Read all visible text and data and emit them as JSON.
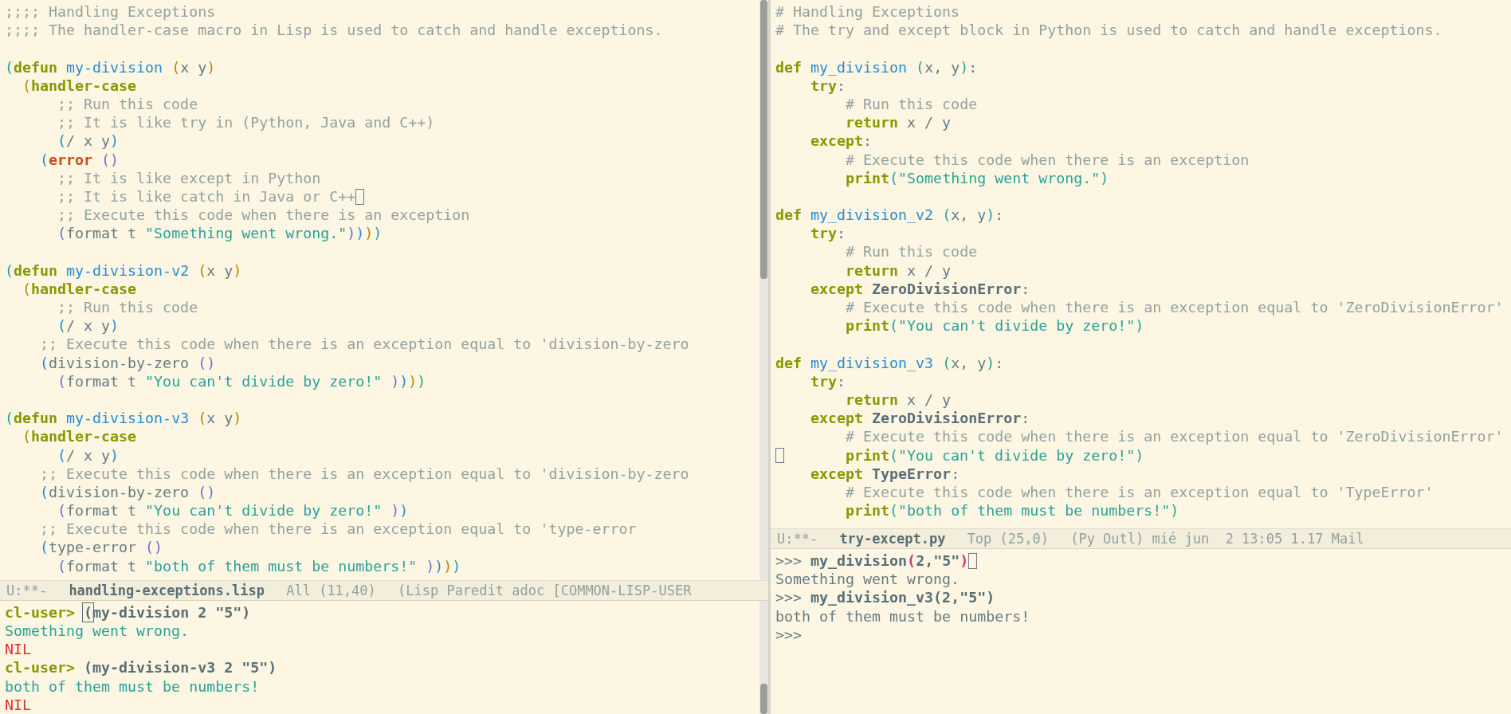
{
  "left_editor": {
    "lines": [
      {
        "tokens": [
          {
            "kind": "c",
            "text": ";;;; Handling Exceptions"
          }
        ]
      },
      {
        "tokens": [
          {
            "kind": "c",
            "text": ";;;; The handler-case macro in Lisp is used to catch and handle exceptions."
          }
        ]
      },
      {
        "space_before": true,
        "tokens": [
          {
            "kind": "p1",
            "text": "("
          },
          {
            "kind": "k",
            "text": "defun"
          },
          {
            "kind": "f",
            "text": " my-division"
          },
          {
            "kind": "p2",
            "text": " ("
          },
          {
            "kind": "t",
            "text": "x y"
          },
          {
            "kind": "p2",
            "text": ")"
          }
        ]
      },
      {
        "tokens": [
          {
            "kind": "p2",
            "text": "  ("
          },
          {
            "kind": "k",
            "text": "handler-case"
          }
        ]
      },
      {
        "tokens": [
          {
            "kind": "c",
            "text": "      ;; Run this code"
          }
        ]
      },
      {
        "tokens": [
          {
            "kind": "c",
            "text": "      ;; It is like try in (Python, Java and C++)"
          }
        ]
      },
      {
        "tokens": [
          {
            "kind": "p3",
            "text": "      ("
          },
          {
            "kind": "t",
            "text": "/ x y"
          },
          {
            "kind": "p3",
            "text": ")"
          }
        ]
      },
      {
        "tokens": [
          {
            "kind": "p3",
            "text": "    ("
          },
          {
            "kind": "e",
            "text": "error"
          },
          {
            "kind": "p4",
            "text": " ()"
          }
        ]
      },
      {
        "tokens": [
          {
            "kind": "c",
            "text": "      ;; It is like except in Python"
          }
        ]
      },
      {
        "cursor_at_end": true,
        "tokens": [
          {
            "kind": "c",
            "text": "      ;; It is like catch in Java or C++"
          }
        ]
      },
      {
        "tokens": [
          {
            "kind": "c",
            "text": "      ;; Execute this code when there is an exception"
          }
        ]
      },
      {
        "tokens": [
          {
            "kind": "p4",
            "text": "      ("
          },
          {
            "kind": "t",
            "text": "format t "
          },
          {
            "kind": "s",
            "text": "\"Something went wrong.\""
          },
          {
            "kind": "p4",
            "text": ")"
          },
          {
            "kind": "p3",
            "text": ")"
          },
          {
            "kind": "p2",
            "text": ")"
          },
          {
            "kind": "p1",
            "text": ")"
          }
        ]
      },
      {
        "space_before": true,
        "tokens": [
          {
            "kind": "p1",
            "text": "("
          },
          {
            "kind": "k",
            "text": "defun"
          },
          {
            "kind": "f",
            "text": " my-division-v2"
          },
          {
            "kind": "p2",
            "text": " ("
          },
          {
            "kind": "t",
            "text": "x y"
          },
          {
            "kind": "p2",
            "text": ")"
          }
        ]
      },
      {
        "tokens": [
          {
            "kind": "p2",
            "text": "  ("
          },
          {
            "kind": "k",
            "text": "handler-case"
          }
        ]
      },
      {
        "tokens": [
          {
            "kind": "c",
            "text": "      ;; Run this code"
          }
        ]
      },
      {
        "tokens": [
          {
            "kind": "p3",
            "text": "      ("
          },
          {
            "kind": "t",
            "text": "/ x y"
          },
          {
            "kind": "p3",
            "text": ")"
          }
        ]
      },
      {
        "tokens": [
          {
            "kind": "c",
            "text": "    ;; Execute this code when there is an exception equal to 'division-by-zero"
          }
        ]
      },
      {
        "tokens": [
          {
            "kind": "p3",
            "text": "    ("
          },
          {
            "kind": "t",
            "text": "division-by-zero "
          },
          {
            "kind": "p4",
            "text": "()"
          }
        ]
      },
      {
        "tokens": [
          {
            "kind": "p4",
            "text": "      ("
          },
          {
            "kind": "t",
            "text": "format t "
          },
          {
            "kind": "s",
            "text": "\"You can't divide by zero!\""
          },
          {
            "kind": "p4",
            "text": " )"
          },
          {
            "kind": "p3",
            "text": ")"
          },
          {
            "kind": "p2",
            "text": ")"
          },
          {
            "kind": "p1",
            "text": ")"
          }
        ]
      },
      {
        "space_before": true,
        "tokens": [
          {
            "kind": "p1",
            "text": "("
          },
          {
            "kind": "k",
            "text": "defun"
          },
          {
            "kind": "f",
            "text": " my-division-v3"
          },
          {
            "kind": "p2",
            "text": " ("
          },
          {
            "kind": "t",
            "text": "x y"
          },
          {
            "kind": "p2",
            "text": ")"
          }
        ]
      },
      {
        "tokens": [
          {
            "kind": "p2",
            "text": "  ("
          },
          {
            "kind": "k",
            "text": "handler-case"
          }
        ]
      },
      {
        "tokens": [
          {
            "kind": "p3",
            "text": "      ("
          },
          {
            "kind": "t",
            "text": "/ x y"
          },
          {
            "kind": "p3",
            "text": ")"
          }
        ]
      },
      {
        "tokens": [
          {
            "kind": "c",
            "text": "    ;; Execute this code when there is an exception equal to 'division-by-zero"
          }
        ]
      },
      {
        "tokens": [
          {
            "kind": "p3",
            "text": "    ("
          },
          {
            "kind": "t",
            "text": "division-by-zero "
          },
          {
            "kind": "p4",
            "text": "()"
          }
        ]
      },
      {
        "tokens": [
          {
            "kind": "p4",
            "text": "      ("
          },
          {
            "kind": "t",
            "text": "format t "
          },
          {
            "kind": "s",
            "text": "\"You can't divide by zero!\""
          },
          {
            "kind": "p4",
            "text": " )"
          },
          {
            "kind": "p3",
            "text": ")"
          }
        ]
      },
      {
        "tokens": [
          {
            "kind": "c",
            "text": "    ;; Execute this code when there is an exception equal to 'type-error"
          }
        ]
      },
      {
        "tokens": [
          {
            "kind": "p3",
            "text": "    ("
          },
          {
            "kind": "t",
            "text": "type-error "
          },
          {
            "kind": "p4",
            "text": "()"
          }
        ]
      },
      {
        "tokens": [
          {
            "kind": "p4",
            "text": "      ("
          },
          {
            "kind": "t",
            "text": "format t "
          },
          {
            "kind": "s",
            "text": "\"both of them must be numbers!\""
          },
          {
            "kind": "p4",
            "text": " )"
          },
          {
            "kind": "p3",
            "text": ")"
          },
          {
            "kind": "p2",
            "text": ")"
          },
          {
            "kind": "p1",
            "text": ")"
          }
        ]
      }
    ],
    "mode_line": {
      "state": "U:**-",
      "buffer": "handling-exceptions.lisp",
      "position": "All (11,40)",
      "modes": "(Lisp Paredit adoc [COMMON-LISP-USER"
    }
  },
  "left_repl": {
    "lines": [
      {
        "tokens": [
          {
            "kind": "pr",
            "text": "cl-user> "
          },
          {
            "kind": "b",
            "text": "(",
            "cursor": true
          },
          {
            "kind": "b",
            "text": "my-division 2 \"5\")"
          }
        ]
      },
      {
        "tokens": [
          {
            "kind": "o",
            "text": "Something went wrong."
          }
        ]
      },
      {
        "tokens": [
          {
            "kind": "n",
            "text": "NIL"
          }
        ]
      },
      {
        "tokens": [
          {
            "kind": "pr",
            "text": "cl-user> "
          },
          {
            "kind": "b",
            "text": "(my-division-v3 2 \"5\")"
          }
        ]
      },
      {
        "tokens": [
          {
            "kind": "o",
            "text": "both of them must be numbers!"
          }
        ]
      },
      {
        "tokens": [
          {
            "kind": "n",
            "text": "NIL"
          }
        ]
      }
    ]
  },
  "right_editor": {
    "lines": [
      {
        "tokens": [
          {
            "kind": "c",
            "text": "# Handling Exceptions"
          }
        ]
      },
      {
        "tokens": [
          {
            "kind": "c",
            "text": "# The try and except block in Python is used to catch and handle exceptions."
          }
        ]
      },
      {
        "space_before": true,
        "tokens": [
          {
            "kind": "k",
            "text": "def"
          },
          {
            "kind": "f",
            "text": " my_division"
          },
          {
            "kind": "s",
            "text": " ("
          },
          {
            "kind": "t",
            "text": "x, y"
          },
          {
            "kind": "s",
            "text": ")"
          },
          {
            "kind": "t",
            "text": ":"
          }
        ]
      },
      {
        "tokens": [
          {
            "kind": "k",
            "text": "    try"
          },
          {
            "kind": "t",
            "text": ":"
          }
        ]
      },
      {
        "tokens": [
          {
            "kind": "c",
            "text": "        # Run this code"
          }
        ]
      },
      {
        "tokens": [
          {
            "kind": "k",
            "text": "        return"
          },
          {
            "kind": "t",
            "text": " x / y"
          }
        ]
      },
      {
        "tokens": [
          {
            "kind": "k",
            "text": "    except"
          },
          {
            "kind": "t",
            "text": ":"
          }
        ]
      },
      {
        "tokens": [
          {
            "kind": "c",
            "text": "        # Execute this code when there is an exception"
          }
        ]
      },
      {
        "tokens": [
          {
            "kind": "k",
            "text": "        print"
          },
          {
            "kind": "s",
            "text": "(\"Something went wrong.\")"
          }
        ]
      },
      {
        "space_before": true,
        "tokens": [
          {
            "kind": "k",
            "text": "def"
          },
          {
            "kind": "f",
            "text": " my_division_v2"
          },
          {
            "kind": "s",
            "text": " ("
          },
          {
            "kind": "t",
            "text": "x, y"
          },
          {
            "kind": "s",
            "text": ")"
          },
          {
            "kind": "t",
            "text": ":"
          }
        ]
      },
      {
        "tokens": [
          {
            "kind": "k",
            "text": "    try"
          },
          {
            "kind": "t",
            "text": ":"
          }
        ]
      },
      {
        "tokens": [
          {
            "kind": "c",
            "text": "        # Run this code"
          }
        ]
      },
      {
        "tokens": [
          {
            "kind": "k",
            "text": "        return"
          },
          {
            "kind": "t",
            "text": " x / y"
          }
        ]
      },
      {
        "tokens": [
          {
            "kind": "k",
            "text": "    except"
          },
          {
            "kind": "b",
            "text": " ZeroDivisionError"
          },
          {
            "kind": "t",
            "text": ":"
          }
        ]
      },
      {
        "tokens": [
          {
            "kind": "c",
            "text": "        # Execute this code when there is an exception equal to 'ZeroDivisionError'"
          }
        ]
      },
      {
        "tokens": [
          {
            "kind": "k",
            "text": "        print"
          },
          {
            "kind": "s",
            "text": "(\"You can't divide by zero!\")"
          }
        ]
      },
      {
        "space_before": true,
        "tokens": [
          {
            "kind": "k",
            "text": "def"
          },
          {
            "kind": "f",
            "text": " my_division_v3"
          },
          {
            "kind": "s",
            "text": " ("
          },
          {
            "kind": "t",
            "text": "x, y"
          },
          {
            "kind": "s",
            "text": ")"
          },
          {
            "kind": "t",
            "text": ":"
          }
        ]
      },
      {
        "tokens": [
          {
            "kind": "k",
            "text": "    try"
          },
          {
            "kind": "t",
            "text": ":"
          }
        ]
      },
      {
        "tokens": [
          {
            "kind": "k",
            "text": "        return"
          },
          {
            "kind": "t",
            "text": " x / y"
          }
        ]
      },
      {
        "tokens": [
          {
            "kind": "k",
            "text": "    except"
          },
          {
            "kind": "b",
            "text": " ZeroDivisionError"
          },
          {
            "kind": "t",
            "text": ":"
          }
        ]
      },
      {
        "tokens": [
          {
            "kind": "c",
            "text": "        # Execute this code when there is an exception equal to 'ZeroDivisionError'"
          }
        ]
      },
      {
        "cursor_at_start": true,
        "tokens": [
          {
            "kind": "k",
            "text": "       print"
          },
          {
            "kind": "s",
            "text": "(\"You can't divide by zero!\")"
          }
        ]
      },
      {
        "tokens": [
          {
            "kind": "k",
            "text": "    except"
          },
          {
            "kind": "b",
            "text": " TypeError"
          },
          {
            "kind": "t",
            "text": ":"
          }
        ]
      },
      {
        "tokens": [
          {
            "kind": "c",
            "text": "        # Execute this code when there is an exception equal to 'TypeError'"
          }
        ]
      },
      {
        "tokens": [
          {
            "kind": "k",
            "text": "        print"
          },
          {
            "kind": "s",
            "text": "(\"both of them must be numbers!\")"
          }
        ]
      }
    ],
    "mode_line": {
      "state": "U:**-",
      "buffer": "try-except.py",
      "position": "Top (25,0)",
      "modes": "(Py Outl) mié jun  2 13:05 1.17 Mail"
    }
  },
  "right_repl": {
    "lines": [
      {
        "cursor_at_end": true,
        "tokens": [
          {
            "kind": "t",
            "text": ">>> "
          },
          {
            "kind": "b",
            "text": "my_division"
          },
          {
            "kind": "m",
            "text": "("
          },
          {
            "kind": "b",
            "text": "2,\"5\""
          },
          {
            "kind": "m",
            "text": ")"
          }
        ]
      },
      {
        "tokens": [
          {
            "kind": "t",
            "text": "Something went wrong."
          }
        ]
      },
      {
        "tokens": [
          {
            "kind": "t",
            "text": ">>> "
          },
          {
            "kind": "b",
            "text": "my_division_v3(2,\"5\")"
          }
        ]
      },
      {
        "tokens": [
          {
            "kind": "t",
            "text": "both of them must be numbers!"
          }
        ]
      },
      {
        "tokens": [
          {
            "kind": "t",
            "text": ">>>"
          }
        ]
      }
    ]
  }
}
